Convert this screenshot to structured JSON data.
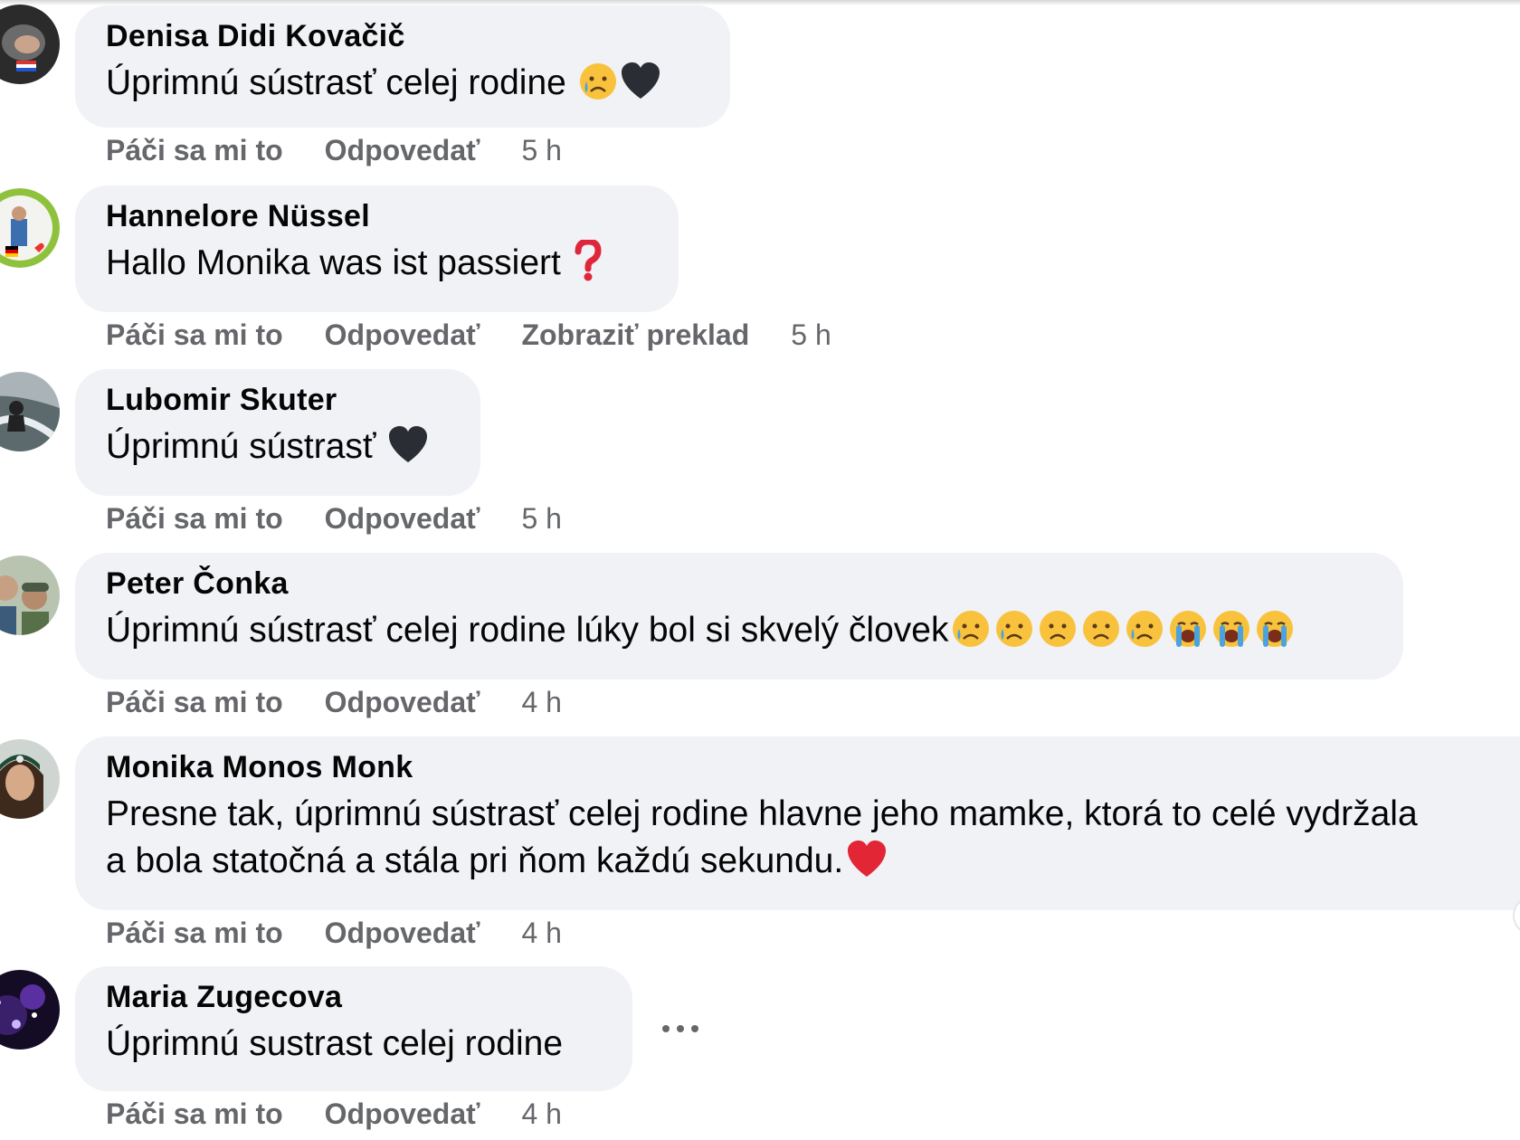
{
  "comments": [
    {
      "author": "Denisa Didi Kovačič",
      "text": "Úprimnú sústrasť celej rodine",
      "emojis": [
        "crying-face-icon",
        "black-heart-icon"
      ],
      "like_label": "Páči sa mi to",
      "reply_label": "Odpovedať",
      "time": "5 h"
    },
    {
      "author": "Hannelore Nüssel",
      "text": "Hallo Monika was ist passiert",
      "emojis": [
        "red-question-mark-icon"
      ],
      "like_label": "Páči sa mi to",
      "reply_label": "Odpovedať",
      "translate_label": "Zobraziť preklad",
      "time": "5 h"
    },
    {
      "author": "Lubomir Skuter",
      "text": "Úprimnú sústrasť",
      "emojis": [
        "black-heart-icon"
      ],
      "like_label": "Páči sa mi to",
      "reply_label": "Odpovedať",
      "time": "5 h"
    },
    {
      "author": "Peter Čonka",
      "text": "Úprimnú sústrasť celej rodine lúky bol si skvelý človek",
      "emojis": [
        "crying-face-icon",
        "crying-face-icon",
        "sad-face-icon",
        "sad-face-icon",
        "crying-face-icon",
        "loudly-crying-face-icon",
        "loudly-crying-face-icon",
        "loudly-crying-face-icon"
      ],
      "like_label": "Páči sa mi to",
      "reply_label": "Odpovedať",
      "time": "4 h"
    },
    {
      "author": "Monika Monos Monk",
      "text_line1": "Presne tak, úprimnú sústrasť celej rodine hlavne jeho mamke, ktorá to celé vydržala",
      "text_line2": "a bola statočná a stála pri ňom každú sekundu.",
      "emojis": [
        "red-heart-icon"
      ],
      "like_label": "Páči sa mi to",
      "reply_label": "Odpovedať",
      "time": "4 h"
    },
    {
      "author": "Maria Zugecova",
      "text": "Úprimnú sustrast celej rodine",
      "like_label": "Páči sa mi to",
      "reply_label": "Odpovedať",
      "time": "4 h"
    }
  ],
  "colors": {
    "bubble_bg": "#f0f2f5",
    "secondary_text": "#65676b",
    "primary_text": "#050505"
  }
}
